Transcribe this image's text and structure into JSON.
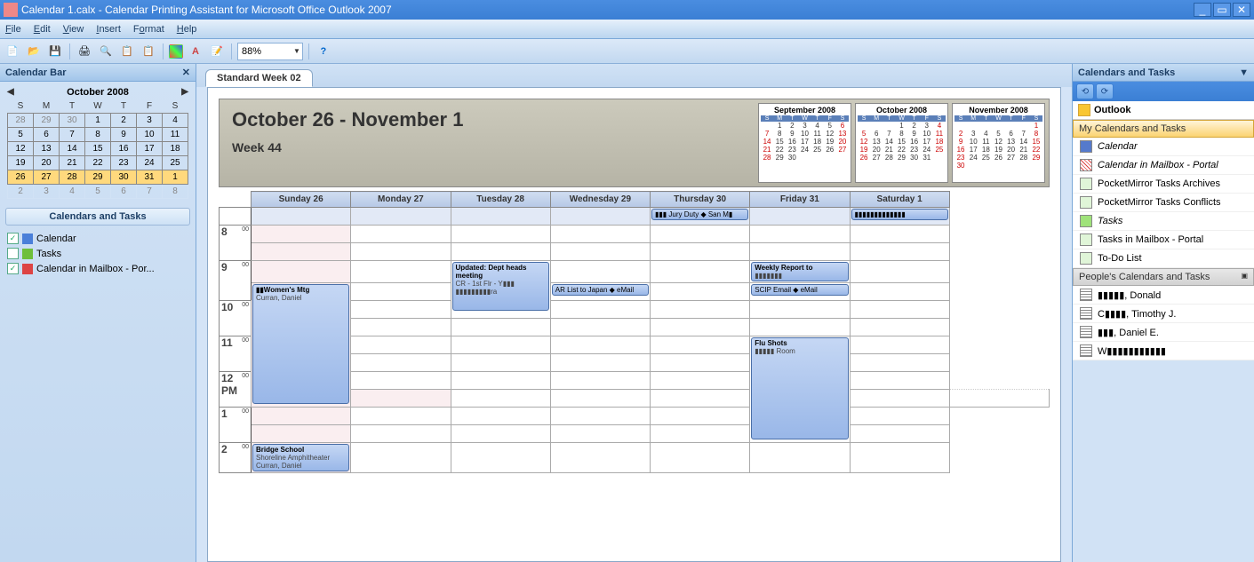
{
  "window": {
    "title": "Calendar 1.calx - Calendar Printing Assistant for Microsoft Office Outlook 2007"
  },
  "menu": [
    "File",
    "Edit",
    "View",
    "Insert",
    "Format",
    "Help"
  ],
  "toolbar": {
    "zoom": "88%"
  },
  "leftpane": {
    "title": "Calendar Bar",
    "minical_title": "October 2008",
    "dow": [
      "S",
      "M",
      "T",
      "W",
      "T",
      "F",
      "S"
    ],
    "rows": [
      {
        "boxed": true,
        "cells": [
          {
            "t": "28",
            "d": true
          },
          {
            "t": "29",
            "d": true
          },
          {
            "t": "30",
            "d": true
          },
          {
            "t": "1"
          },
          {
            "t": "2"
          },
          {
            "t": "3"
          },
          {
            "t": "4"
          }
        ]
      },
      {
        "boxed": true,
        "cells": [
          {
            "t": "5"
          },
          {
            "t": "6"
          },
          {
            "t": "7"
          },
          {
            "t": "8"
          },
          {
            "t": "9"
          },
          {
            "t": "10"
          },
          {
            "t": "11"
          }
        ]
      },
      {
        "boxed": true,
        "cells": [
          {
            "t": "12"
          },
          {
            "t": "13"
          },
          {
            "t": "14"
          },
          {
            "t": "15"
          },
          {
            "t": "16"
          },
          {
            "t": "17"
          },
          {
            "t": "18"
          }
        ]
      },
      {
        "boxed": true,
        "cells": [
          {
            "t": "19"
          },
          {
            "t": "20"
          },
          {
            "t": "21"
          },
          {
            "t": "22"
          },
          {
            "t": "23"
          },
          {
            "t": "24"
          },
          {
            "t": "25"
          }
        ]
      },
      {
        "boxed": true,
        "cur": true,
        "cells": [
          {
            "t": "26"
          },
          {
            "t": "27"
          },
          {
            "t": "28"
          },
          {
            "t": "29"
          },
          {
            "t": "30"
          },
          {
            "t": "31"
          },
          {
            "t": "1"
          }
        ]
      },
      {
        "cells": [
          {
            "t": "2",
            "d": true
          },
          {
            "t": "3",
            "d": true
          },
          {
            "t": "4",
            "d": true
          },
          {
            "t": "5",
            "d": true
          },
          {
            "t": "6",
            "d": true
          },
          {
            "t": "7",
            "d": true
          },
          {
            "t": "8",
            "d": true
          }
        ]
      }
    ],
    "section2": "Calendars and Tasks",
    "items": [
      {
        "chk": true,
        "icon": "blue",
        "label": "Calendar"
      },
      {
        "chk": false,
        "icon": "green",
        "label": "Tasks"
      },
      {
        "chk": true,
        "icon": "hat",
        "label": "Calendar in Mailbox - Por..."
      }
    ]
  },
  "center": {
    "tab": "Standard Week 02",
    "range": "October 26 - November 1",
    "week": "Week 44",
    "minicals": [
      {
        "title": "September 2008",
        "dow": [
          "S",
          "M",
          "T",
          "W",
          "T",
          "F",
          "S"
        ],
        "rows": [
          [
            "",
            "1",
            "2",
            "3",
            "4",
            "5",
            "6"
          ],
          [
            "7",
            "8",
            "9",
            "10",
            "11",
            "12",
            "13"
          ],
          [
            "14",
            "15",
            "16",
            "17",
            "18",
            "19",
            "20"
          ],
          [
            "21",
            "22",
            "23",
            "24",
            "25",
            "26",
            "27"
          ],
          [
            "28",
            "29",
            "30",
            "",
            "",
            "",
            ""
          ]
        ]
      },
      {
        "title": "October 2008",
        "dow": [
          "S",
          "M",
          "T",
          "W",
          "T",
          "F",
          "S"
        ],
        "rows": [
          [
            "",
            "",
            "",
            "1",
            "2",
            "3",
            "4"
          ],
          [
            "5",
            "6",
            "7",
            "8",
            "9",
            "10",
            "11"
          ],
          [
            "12",
            "13",
            "14",
            "15",
            "16",
            "17",
            "18"
          ],
          [
            "19",
            "20",
            "21",
            "22",
            "23",
            "24",
            "25"
          ],
          [
            "26",
            "27",
            "28",
            "29",
            "30",
            "31",
            ""
          ]
        ]
      },
      {
        "title": "November 2008",
        "dow": [
          "S",
          "M",
          "T",
          "W",
          "T",
          "F",
          "S"
        ],
        "rows": [
          [
            "",
            "",
            "",
            "",
            "",
            "",
            "1"
          ],
          [
            "2",
            "3",
            "4",
            "5",
            "6",
            "7",
            "8"
          ],
          [
            "9",
            "10",
            "11",
            "12",
            "13",
            "14",
            "15"
          ],
          [
            "16",
            "17",
            "18",
            "19",
            "20",
            "21",
            "22"
          ],
          [
            "23",
            "24",
            "25",
            "26",
            "27",
            "28",
            "29"
          ],
          [
            "30",
            "",
            "",
            "",
            "",
            "",
            ""
          ]
        ]
      }
    ],
    "days": [
      "Sunday 26",
      "Monday 27",
      "Tuesday 28",
      "Wednesday 29",
      "Thursday 30",
      "Friday 31",
      "Saturday 1"
    ],
    "hours": [
      "",
      "8",
      "",
      "9",
      "",
      "10",
      "",
      "11",
      "",
      "12 PM",
      "",
      "1",
      "",
      "2"
    ],
    "half": [
      "",
      "00",
      "30",
      "00",
      "30",
      "00",
      "30",
      "00",
      "30",
      "00",
      "30",
      "00",
      "30",
      "00"
    ],
    "allday": {
      "thu": "▮▮▮ Jury Duty ◆ San M▮",
      "sat": "▮▮▮▮▮▮▮▮▮▮▮▮▮"
    },
    "events": {
      "sun_930": {
        "t": "▮▮Women's Mtg",
        "s": "Curran, Daniel"
      },
      "tue_9": {
        "t": "Updated: Dept heads meeting",
        "s": "CR - 1st Flr - Y▮▮▮",
        "s2": "▮▮▮▮▮▮▮▮▮ra"
      },
      "wed_930": {
        "t": "AR List to Japan ◆ eMail"
      },
      "fri_9": {
        "t": "Weekly Report to",
        "s": "▮▮▮▮▮▮▮"
      },
      "fri_930": {
        "t": "SCIP Email ◆ eMail"
      },
      "fri_11": {
        "t": "Flu Shots",
        "s": "▮▮▮▮▮ Room"
      },
      "sun_2": {
        "t": "Bridge School",
        "s": "Shoreline Amphitheater",
        "s2": "Curran, Daniel"
      }
    }
  },
  "right": {
    "title": "Calendars and Tasks",
    "outlook": "Outlook",
    "sect_my": "My Calendars and Tasks",
    "my_items": [
      {
        "ic": "blue",
        "italic": true,
        "label": "Calendar"
      },
      {
        "ic": "redgrid",
        "italic": true,
        "label": "Calendar in Mailbox - Portal"
      },
      {
        "ic": "green",
        "label": "PocketMirror Tasks Archives"
      },
      {
        "ic": "green",
        "label": "PocketMirror Tasks Conflicts"
      },
      {
        "ic": "grn2",
        "italic": true,
        "label": "Tasks"
      },
      {
        "ic": "green",
        "label": "Tasks in Mailbox - Portal"
      },
      {
        "ic": "green",
        "label": "To-Do List"
      }
    ],
    "sect_people": "People's Calendars and Tasks",
    "people": [
      {
        "ic": "hatch",
        "label": "▮▮▮▮▮, Donald"
      },
      {
        "ic": "hatch",
        "label": "C▮▮▮▮, Timothy J."
      },
      {
        "ic": "hatch",
        "label": "▮▮▮, Daniel E."
      },
      {
        "ic": "hatch",
        "label": "W▮▮▮▮▮▮▮▮▮▮▮"
      }
    ]
  }
}
